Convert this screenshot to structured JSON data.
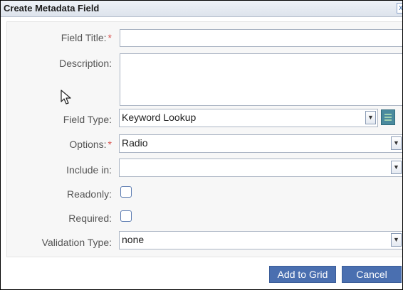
{
  "dialog": {
    "title": "Create Metadata Field",
    "close_glyph": "x"
  },
  "form": {
    "field_title": {
      "label": "Field Title:",
      "required_mark": "*",
      "value": ""
    },
    "description": {
      "label": "Description:",
      "value": ""
    },
    "field_type": {
      "label": "Field Type:",
      "selected": "Keyword Lookup"
    },
    "options": {
      "label": "Options:",
      "required_mark": "*",
      "selected": "Radio"
    },
    "include_in": {
      "label": "Include in:",
      "selected": ""
    },
    "readonly": {
      "label": "Readonly:",
      "checked": false
    },
    "required": {
      "label": "Required:",
      "checked": false
    },
    "validation_type": {
      "label": "Validation Type:",
      "selected": "none"
    }
  },
  "buttons": {
    "add_to_grid": "Add to Grid",
    "cancel": "Cancel"
  },
  "icons": {
    "close": "close-icon",
    "dropdown": "chevron-down-icon",
    "grid": "grid-icon",
    "cursor": "mouse-cursor-icon"
  },
  "colors": {
    "button_bg": "#4a6fb0",
    "required": "#d9534f",
    "grid_button": "#4a8a9e"
  }
}
